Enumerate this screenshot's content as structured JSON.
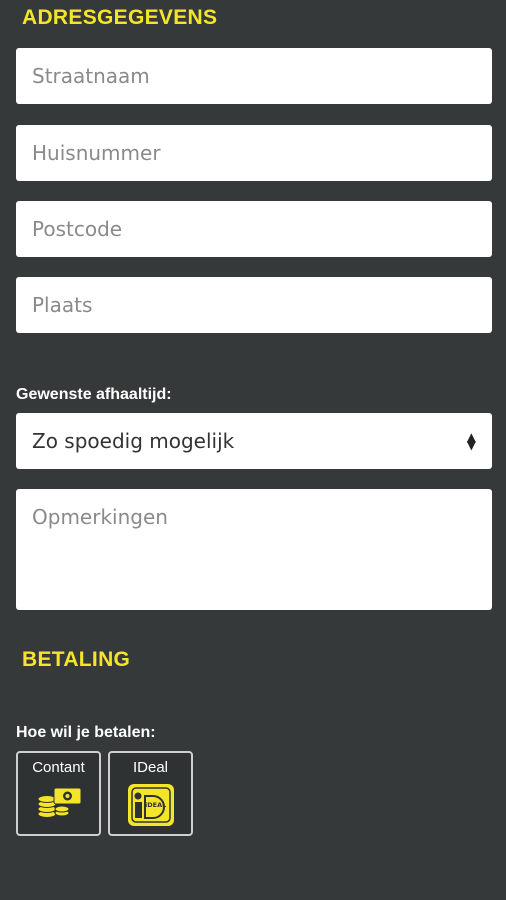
{
  "address": {
    "title": "ADRESGEGEVENS",
    "street_placeholder": "Straatnaam",
    "house_number_placeholder": "Huisnummer",
    "postcode_placeholder": "Postcode",
    "city_placeholder": "Plaats"
  },
  "pickup": {
    "label": "Gewenste afhaaltijd:",
    "selected": "Zo spoedig mogelijk"
  },
  "remarks": {
    "placeholder": "Opmerkingen"
  },
  "payment": {
    "title": "BETALING",
    "label": "Hoe wil je betalen:",
    "options": [
      {
        "label": "Contant",
        "icon": "cash-icon"
      },
      {
        "label": "IDeal",
        "icon": "ideal-icon",
        "icon_text": "iDEAL"
      }
    ]
  },
  "colors": {
    "background": "#363939",
    "accent": "#f5e52a",
    "field_background": "#ffffff"
  }
}
